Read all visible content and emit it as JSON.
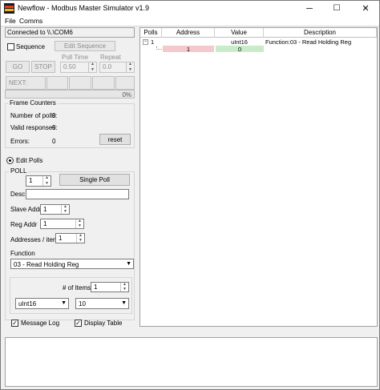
{
  "window": {
    "title": "Newflow - Modbus Master Simulator v1.9",
    "minimize": "─",
    "maximize": "☐",
    "close": "✕"
  },
  "menu": [
    "File",
    "Comms"
  ],
  "connection": "Connected to \\\\.\\COM6",
  "sequence": {
    "checkbox_label": "Sequence",
    "edit_label": "Edit Sequence",
    "go_label": "GO",
    "stop_label": "STOP",
    "poll_time_label": "Poll Time",
    "poll_time_value": "0.50",
    "repeat_label": "Repeat",
    "repeat_value": "0.0",
    "next_label": "NEXT:",
    "progress_text": "0%",
    "progress": 0
  },
  "frame_counters": {
    "title": "Frame Counters",
    "polls_label": "Number of polls:",
    "polls_value": "0",
    "valid_label": "Valid responses:",
    "valid_value": "0",
    "errors_label": "Errors:",
    "errors_value": "0",
    "reset_label": "reset"
  },
  "edit_polls_label": "Edit Polls",
  "poll": {
    "title": "POLL",
    "poll_number": "1",
    "single_poll_label": "Single Poll",
    "desc_label": "Desc",
    "desc_value": "",
    "slave_addr_label": "Slave Addr",
    "slave_addr_value": "1",
    "reg_addr_label": "Reg Addr",
    "reg_addr_value": "1",
    "addresses_label": "Addresses / item",
    "addresses_value": "1",
    "function_label": "Function",
    "function_value": "03 - Read Holding Reg",
    "items_label": "# of Items",
    "items_value": "1",
    "type_value": "uInt16",
    "format_value": "10"
  },
  "options": {
    "message_log_label": "Message Log",
    "display_table_label": "Display Table"
  },
  "table": {
    "headers": [
      "Polls",
      "Address",
      "Value",
      "Description"
    ],
    "rows": [
      {
        "poll": "1",
        "address": "",
        "value": "uInt16",
        "description": "Function:03 - Read Holding Reg"
      },
      {
        "poll": "",
        "address": "1",
        "value": "0",
        "description": ""
      }
    ],
    "address_color": "#f4c8cc",
    "value_color": "#c8ecc8"
  }
}
